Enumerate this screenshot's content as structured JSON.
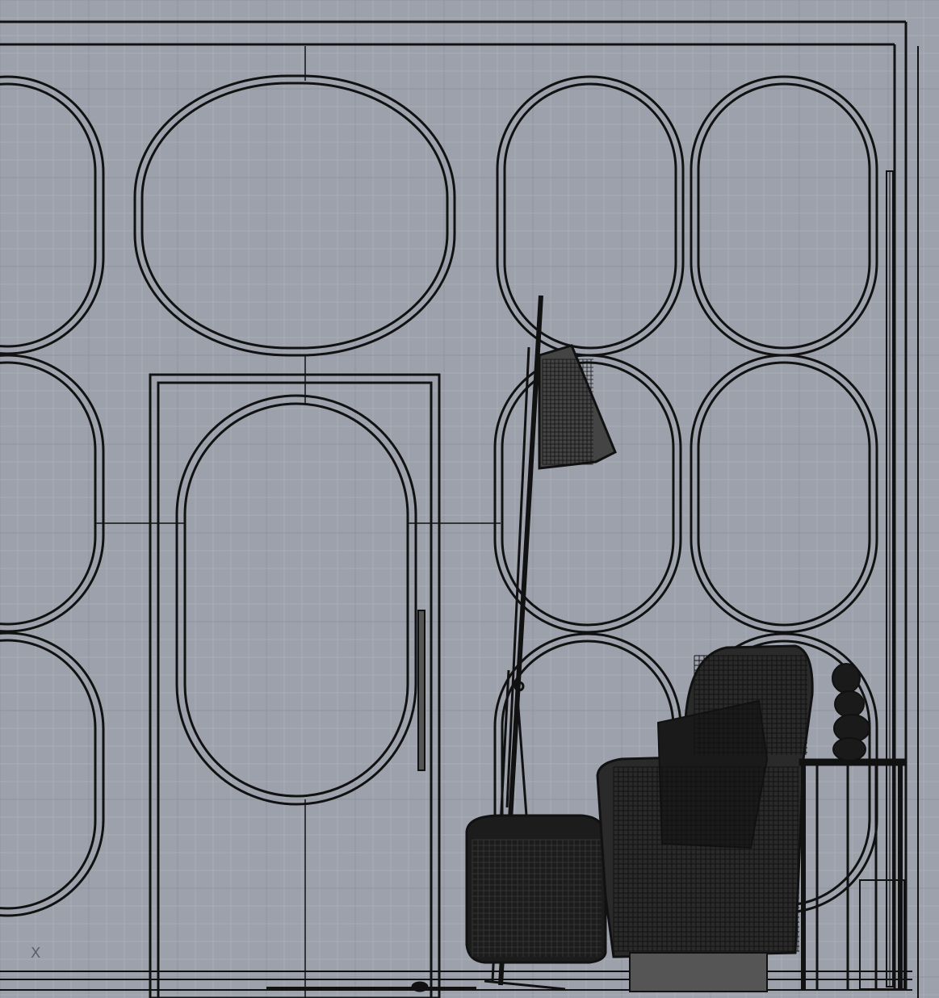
{
  "viewport": {
    "axis_label": "X",
    "colors": {
      "background": "#9ca1ab",
      "grid_minor": "#a8adb6",
      "grid_major": "#8e939c",
      "wireframe": "#111111"
    },
    "view_mode": "wireframe",
    "grid": true
  }
}
